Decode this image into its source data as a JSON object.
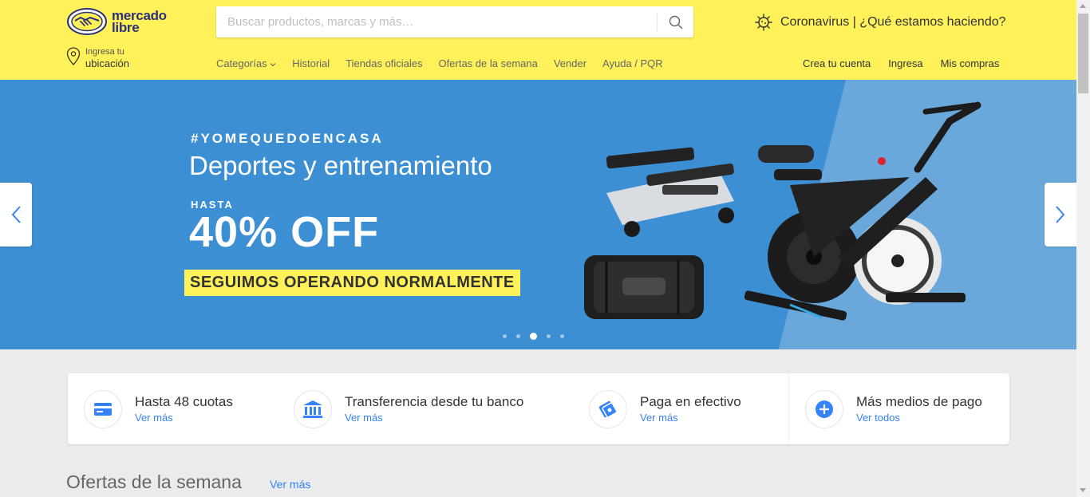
{
  "brand": {
    "line1": "mercado",
    "line2": "libre",
    "color": "#2d3277",
    "yellow": "#fff159"
  },
  "search": {
    "placeholder": "Buscar productos, marcas y más…",
    "value": "",
    "icon": "search-icon"
  },
  "promo": {
    "text": "Coronavirus | ¿Qué estamos haciendo?",
    "icon": "virus-icon"
  },
  "location": {
    "small": "Ingresa tu",
    "big": "ubicación",
    "icon": "location-pin-icon"
  },
  "nav": [
    "Categorías",
    "Historial",
    "Tiendas oficiales",
    "Ofertas de la semana",
    "Vender",
    "Ayuda / PQR"
  ],
  "user_nav": [
    "Crea tu cuenta",
    "Ingresa",
    "Mis compras"
  ],
  "hero": {
    "tag": "#YOMEQUEDOENCASA",
    "title": "Deportes y entrenamiento",
    "hasta": "HASTA",
    "discount": "40% OFF",
    "badge": "SEGUIMOS OPERANDO NORMALMENTE",
    "bg_color": "#3d8fd3",
    "slides_total": 5,
    "active_slide": 3
  },
  "payment": [
    {
      "title": "Hasta 48 cuotas",
      "link": "Ver más",
      "icon": "credit-card-icon"
    },
    {
      "title": "Transferencia desde tu banco",
      "link": "Ver más",
      "icon": "bank-icon"
    },
    {
      "title": "Paga en efectivo",
      "link": "Ver más",
      "icon": "cash-icon"
    },
    {
      "title": "Más medios de pago",
      "link": "Ver todos",
      "icon": "plus-icon"
    }
  ],
  "offers": {
    "title": "Ofertas de la semana",
    "link": "Ver más"
  },
  "link_color": "#3483fa"
}
